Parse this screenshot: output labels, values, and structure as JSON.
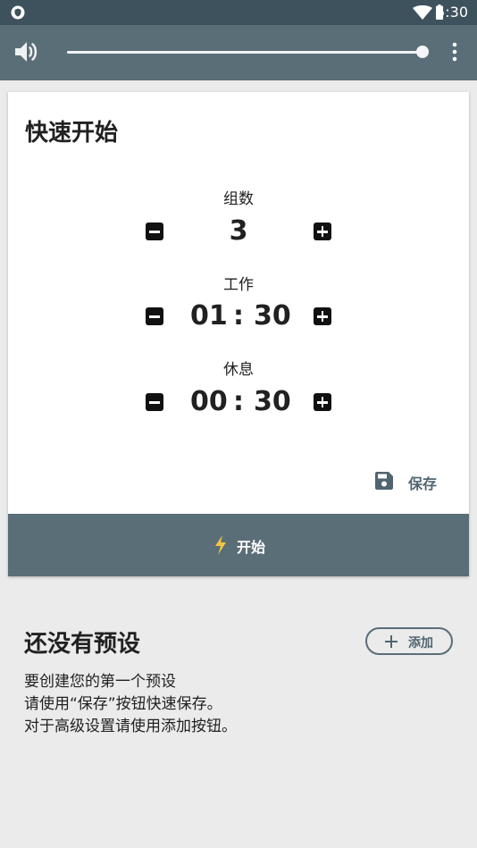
{
  "status_bar": {
    "time": "5:30",
    "icons": [
      "shield-icon",
      "wifi-icon",
      "battery-icon"
    ]
  },
  "toolbar": {
    "volume_icon": "volume-up-icon",
    "volume_level": 1.0,
    "menu_icon": "more-vert-icon"
  },
  "quick_start": {
    "title": "快速开始",
    "sets": {
      "label": "组数",
      "value": "3"
    },
    "work": {
      "label": "工作",
      "minutes": "01",
      "separator": ":",
      "seconds": "30"
    },
    "rest": {
      "label": "休息",
      "minutes": "00",
      "separator": ":",
      "seconds": "30"
    },
    "save_label": "保存",
    "start_label": "开始"
  },
  "presets": {
    "title": "还没有预设",
    "add_label": "添加",
    "description_lines": [
      "要创建您的第一个预设",
      "请使用“保存”按钮快速保存。",
      "对于高级设置请使用添加按钮。"
    ]
  },
  "colors": {
    "status_bar": "#3e525d",
    "primary": "#5a6e78",
    "background": "#ebebeb",
    "card": "#ffffff",
    "accent_bolt": "#f5c542"
  }
}
